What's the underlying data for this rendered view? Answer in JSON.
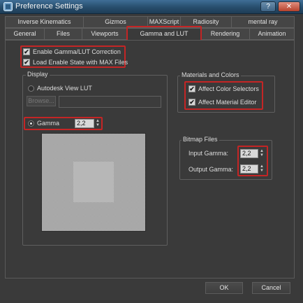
{
  "window": {
    "title": "Preference Settings",
    "help_label": "?",
    "close_label": "✕"
  },
  "tabs": {
    "row1": [
      "Inverse Kinematics",
      "Gizmos",
      "MAXScript",
      "Radiosity",
      "mental ray"
    ],
    "row2": [
      "General",
      "Files",
      "Viewports",
      "Gamma and LUT",
      "Rendering",
      "Animation"
    ],
    "active": "Gamma and LUT"
  },
  "options": {
    "enable_gamma": {
      "label": "Enable Gamma/LUT Correction",
      "checked": true
    },
    "load_state": {
      "label": "Load Enable State with MAX Files",
      "checked": true
    }
  },
  "display": {
    "title": "Display",
    "lut_label": "Autodesk View LUT",
    "browse_label": "Browse...",
    "gamma_label": "Gamma",
    "gamma_value": "2,2"
  },
  "materials": {
    "title": "Materials and Colors",
    "affect_color": {
      "label": "Affect Color Selectors",
      "checked": true
    },
    "affect_material": {
      "label": "Affect Material Editor",
      "checked": true
    }
  },
  "bitmap": {
    "title": "Bitmap Files",
    "input_label": "Input Gamma:",
    "input_value": "2,2",
    "output_label": "Output Gamma:",
    "output_value": "2,2"
  },
  "buttons": {
    "ok": "OK",
    "cancel": "Cancel"
  },
  "colors": {
    "highlight": "#c42525",
    "titlebar": "#2f5878",
    "background": "#3a3a3a"
  },
  "icons": {
    "app": "app-icon",
    "check": "✔",
    "spin_up": "▲",
    "spin_down": "▼"
  }
}
